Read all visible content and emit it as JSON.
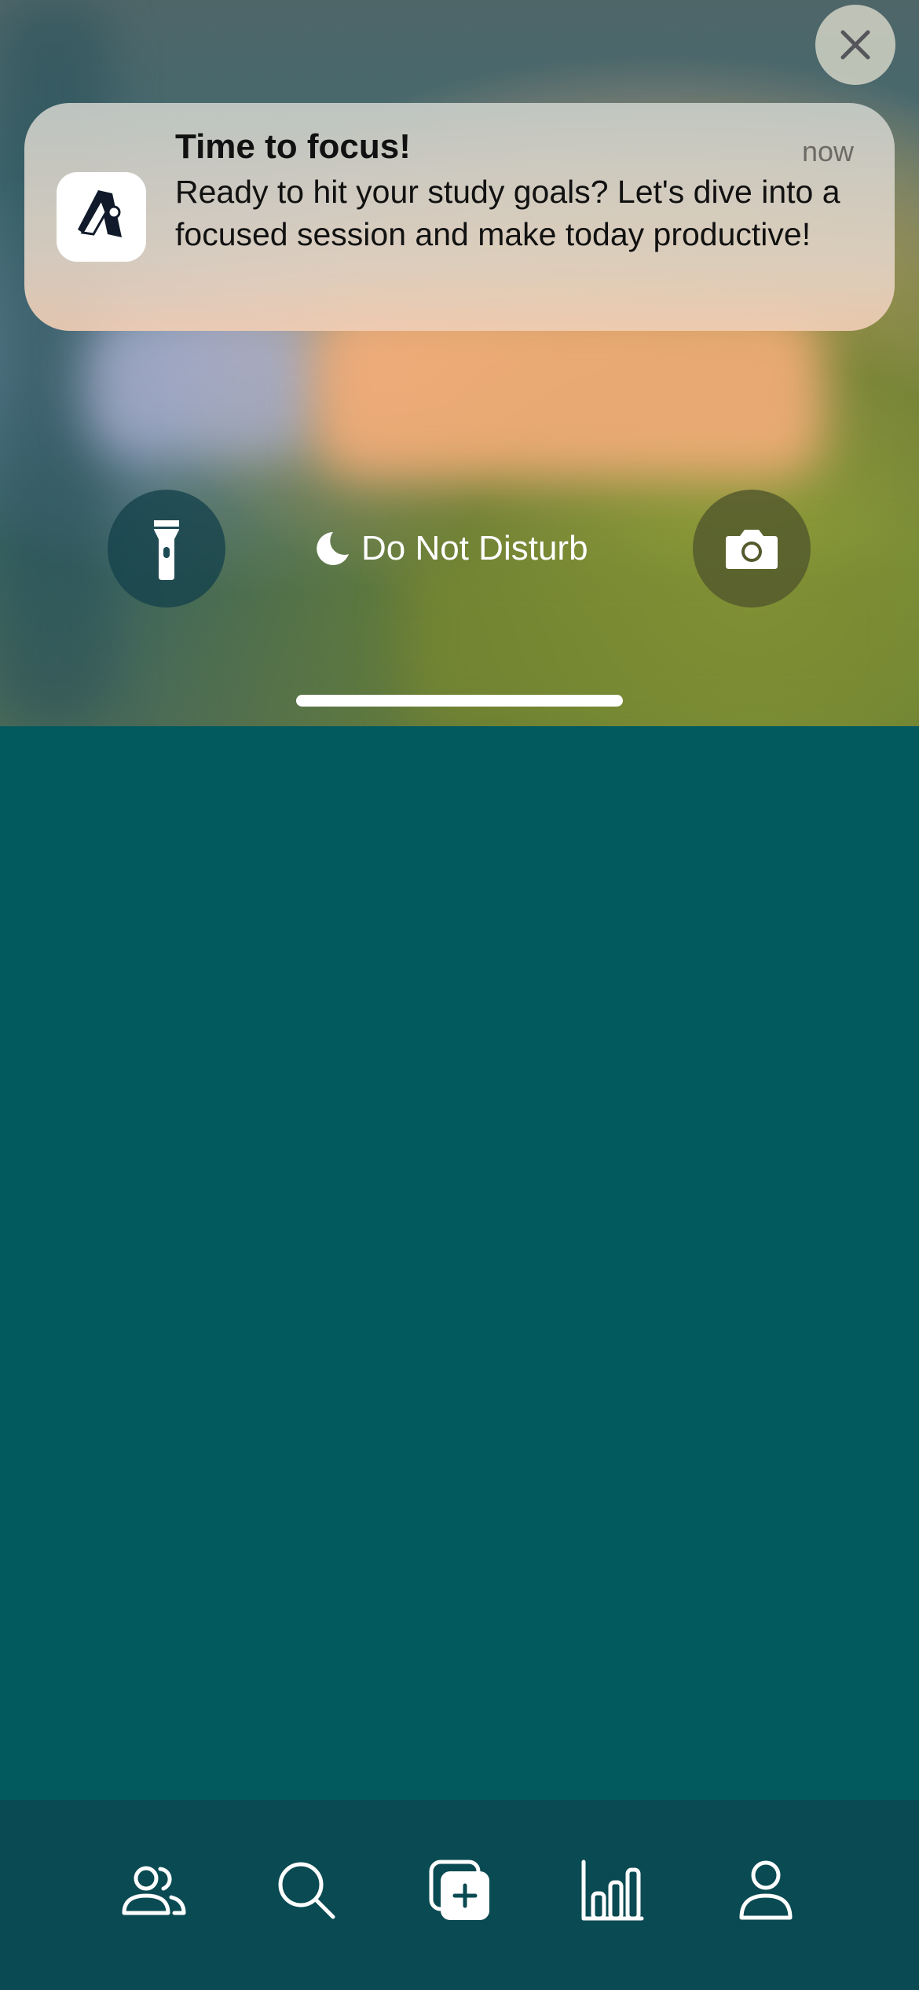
{
  "notification": {
    "title": "Time to focus!",
    "time": "now",
    "body": "Ready to hit your study goals? Let's dive into a focused session and make today productive!",
    "app_icon": "app-logo-icon"
  },
  "lock_screen": {
    "focus_mode_label": "Do Not Disturb",
    "focus_mode_icon": "moon-icon",
    "left_control_icon": "flashlight-icon",
    "right_control_icon": "camera-icon"
  },
  "controls": {
    "close_icon": "close-icon"
  },
  "tab_bar": {
    "background": "#0a4a52",
    "items": [
      {
        "icon": "people-icon"
      },
      {
        "icon": "search-icon"
      },
      {
        "icon": "add-card-icon"
      },
      {
        "icon": "stats-icon"
      },
      {
        "icon": "profile-icon"
      }
    ]
  },
  "colors": {
    "main_background": "#035a5e",
    "tab_bar": "#0a4a52",
    "notification_title": "#111111",
    "notification_time": "#6d6a66"
  }
}
